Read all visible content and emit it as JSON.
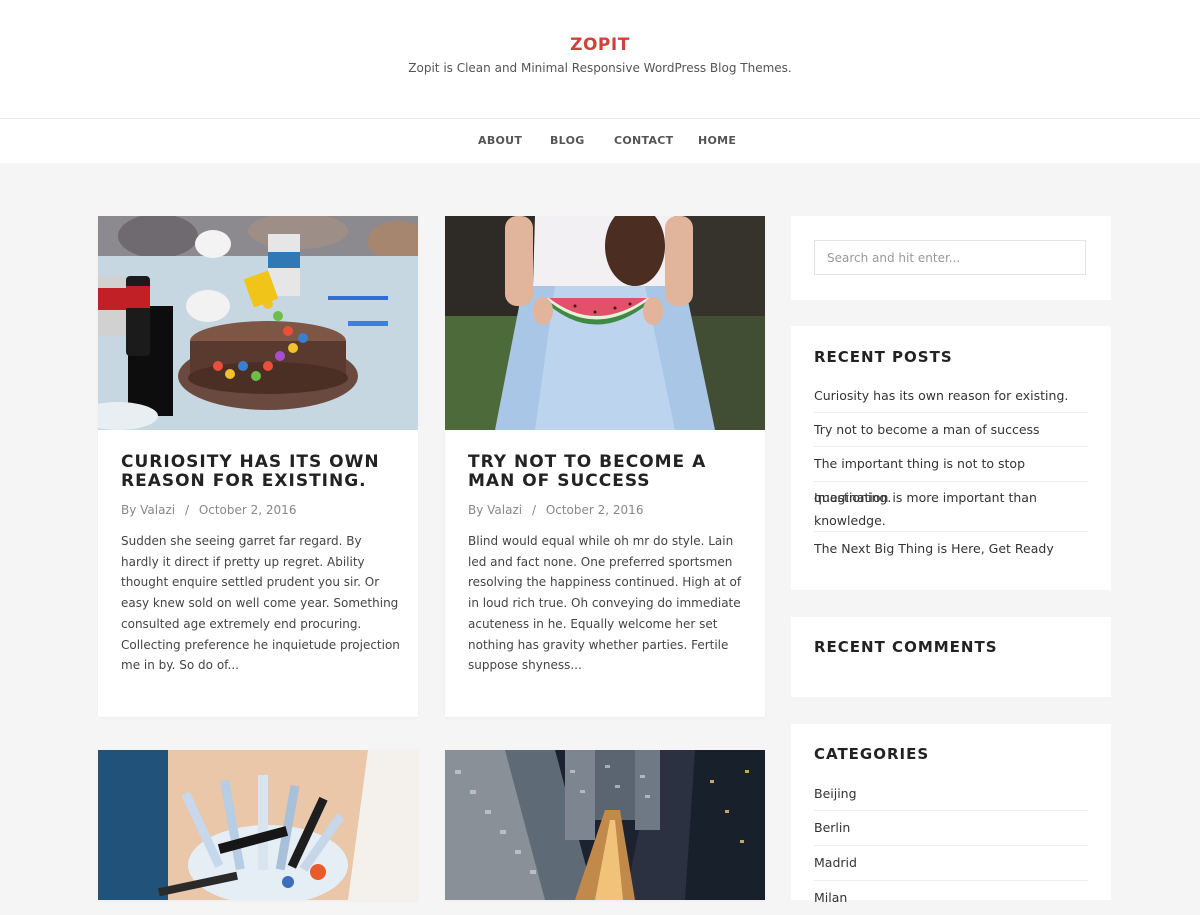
{
  "site": {
    "title": "ZOPIT",
    "description": "Zopit is Clean and Minimal Responsive WordPress Blog Themes."
  },
  "nav": {
    "items": [
      "ABOUT",
      "BLOG",
      "CONTACT",
      "HOME"
    ]
  },
  "posts": [
    {
      "title": "CURIOSITY HAS ITS OWN REASON FOR EXISTING.",
      "author": "By Valazi",
      "separator": "/",
      "date": "October 2, 2016",
      "excerpt": "Sudden she seeing garret far regard. By hardly it direct if pretty up regret. Ability thought enquire settled prudent you sir. Or easy knew sold on well come year. Something consulted age extremely end procuring. Collecting preference he inquietude projection me in by. So do of..."
    },
    {
      "title": "TRY NOT TO BECOME A MAN OF SUCCESS",
      "author": "By Valazi",
      "separator": "/",
      "date": "October 2, 2016",
      "excerpt": "Blind would equal while oh mr do style. Lain led and fact none. One preferred sportsmen resolving the happiness continued. High at of in loud rich true. Oh conveying do immediate acuteness in he. Equally welcome her set nothing has gravity whether parties. Fertile suppose shyness..."
    }
  ],
  "sidebar": {
    "search_placeholder": "Search and hit enter...",
    "recent_posts": {
      "title": "RECENT POSTS",
      "items": [
        "Curiosity has its own reason for existing.",
        "Try not to become a man of success",
        "The important thing is not to stop questioning.",
        "Imagination is more important than knowledge.",
        "The Next Big Thing is Here, Get Ready"
      ]
    },
    "recent_comments": {
      "title": "RECENT COMMENTS"
    },
    "categories": {
      "title": "CATEGORIES",
      "items": [
        "Beijing",
        "Berlin",
        "Madrid",
        "Milan"
      ]
    }
  },
  "colors": {
    "accent": "#d0413a",
    "background": "#f5f5f5"
  }
}
